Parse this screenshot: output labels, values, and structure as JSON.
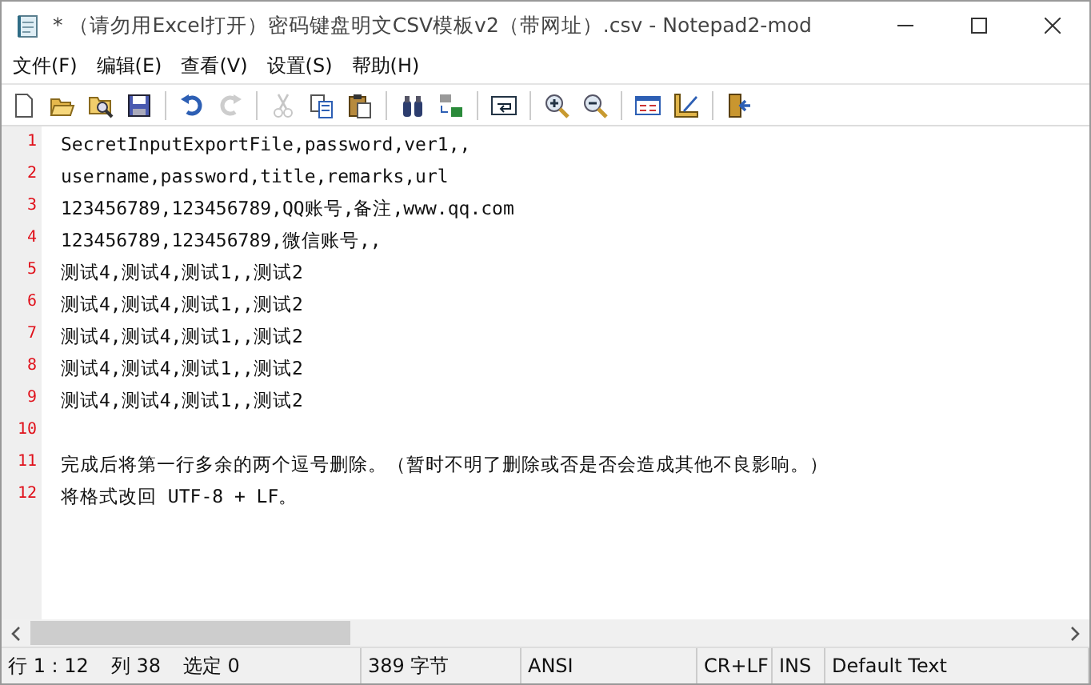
{
  "window": {
    "title": "*  （请勿用Excel打开）密码键盘明文CSV模板v2（带网址）.csv - Notepad2-mod"
  },
  "menu": [
    "文件(F)",
    "编辑(E)",
    "查看(V)",
    "设置(S)",
    "帮助(H)"
  ],
  "toolbar": [
    {
      "kind": "new",
      "disabled": false
    },
    {
      "kind": "open",
      "disabled": false
    },
    {
      "kind": "browse",
      "disabled": false
    },
    {
      "kind": "save",
      "disabled": false
    },
    {
      "kind": "separator"
    },
    {
      "kind": "undo",
      "disabled": false
    },
    {
      "kind": "redo",
      "disabled": true
    },
    {
      "kind": "separator"
    },
    {
      "kind": "cut",
      "disabled": true
    },
    {
      "kind": "copy",
      "disabled": false
    },
    {
      "kind": "paste",
      "disabled": false
    },
    {
      "kind": "separator"
    },
    {
      "kind": "find",
      "disabled": false
    },
    {
      "kind": "replace",
      "disabled": false
    },
    {
      "kind": "separator"
    },
    {
      "kind": "wrap",
      "disabled": false
    },
    {
      "kind": "separator"
    },
    {
      "kind": "zoomin",
      "disabled": false
    },
    {
      "kind": "zoomout",
      "disabled": false
    },
    {
      "kind": "separator"
    },
    {
      "kind": "scheme",
      "disabled": false
    },
    {
      "kind": "customize",
      "disabled": false
    },
    {
      "kind": "separator"
    },
    {
      "kind": "exit",
      "disabled": false
    }
  ],
  "editor": {
    "lines": [
      {
        "number": "1",
        "text": "SecretInputExportFile,password,ver1,,"
      },
      {
        "number": "2",
        "text": "username,password,title,remarks,url"
      },
      {
        "number": "3",
        "text": "123456789,123456789,QQ账号,备注,www.qq.com"
      },
      {
        "number": "4",
        "text": "123456789,123456789,微信账号,,"
      },
      {
        "number": "5",
        "text": "测试4,测试4,测试1,,测试2"
      },
      {
        "number": "6",
        "text": "测试4,测试4,测试1,,测试2"
      },
      {
        "number": "7",
        "text": "测试4,测试4,测试1,,测试2"
      },
      {
        "number": "8",
        "text": "测试4,测试4,测试1,,测试2"
      },
      {
        "number": "9",
        "text": "测试4,测试4,测试1,,测试2"
      },
      {
        "number": "10"
      },
      {
        "number": "11",
        "text": "完成后将第一行多余的两个逗号删除。（暂时不明了删除或否是否会造成其他不良影响。）"
      },
      {
        "number": "12",
        "text": "将格式改回 UTF-8 + LF。"
      }
    ]
  },
  "status_bar": [
    [
      "行 1 : 12",
      "列 38",
      "选定 0"
    ],
    [
      "389 字节"
    ],
    [
      "ANSI"
    ],
    [
      "CR+LF"
    ],
    [
      "INS"
    ],
    [
      "Default Text"
    ]
  ]
}
